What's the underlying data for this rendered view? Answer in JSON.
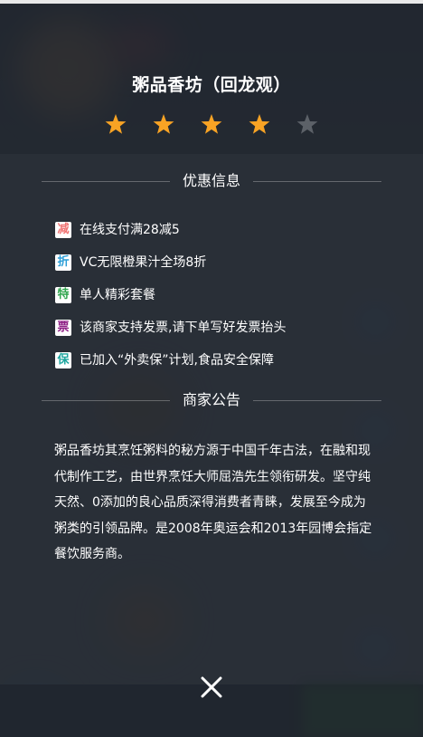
{
  "store": {
    "name": "粥品香坊（回龙观）",
    "rating": 4,
    "rating_max": 5,
    "star_on_color": "#f8a324",
    "star_off_color": "#5c6168"
  },
  "sections": {
    "promo_title": "优惠信息",
    "notice_title": "商家公告"
  },
  "promos": [
    {
      "badge": "减",
      "badge_color": "#f07373",
      "text": "在线支付满28减5"
    },
    {
      "badge": "折",
      "badge_color": "#2b9ed7",
      "text": "VC无限橙果汁全场8折"
    },
    {
      "badge": "特",
      "badge_color": "#31a64f",
      "text": "单人精彩套餐"
    },
    {
      "badge": "票",
      "badge_color": "#8e1f86",
      "text": "该商家支持发票,请下单写好发票抬头"
    },
    {
      "badge": "保",
      "badge_color": "#1fa6a0",
      "text": "已加入“外卖保”计划,食品安全保障"
    }
  ],
  "notice": {
    "text": "粥品香坊其烹饪粥料的秘方源于中国千年古法，在融和现代制作工艺，由世界烹饪大师屈浩先生领衔研发。坚守纯天然、0添加的良心品质深得消费者青睐，发展至今成为粥类的引领品牌。是2008年奥运会和2013年园博会指定餐饮服务商。"
  },
  "close": {
    "icon": "close-icon"
  }
}
